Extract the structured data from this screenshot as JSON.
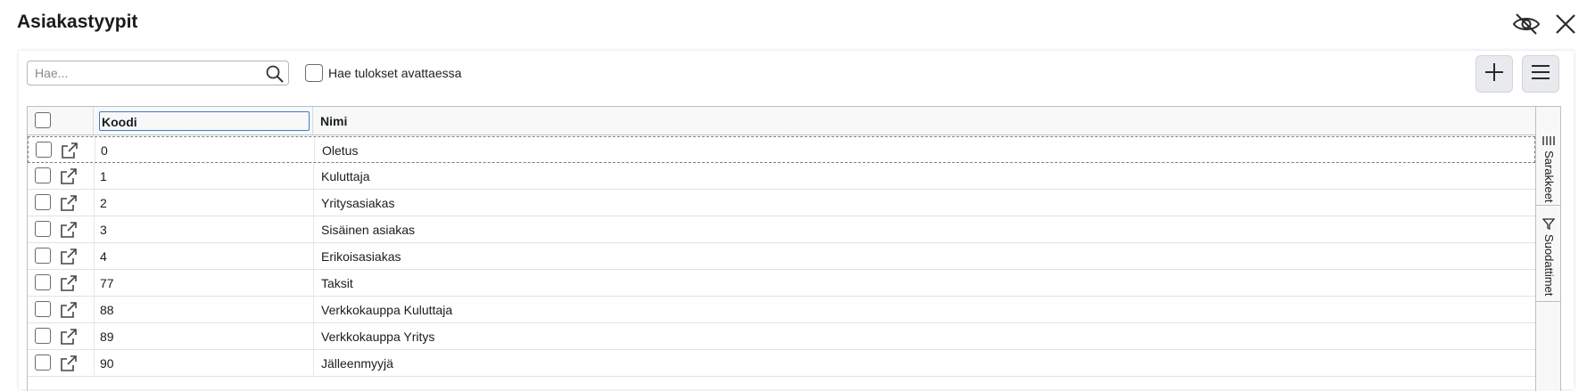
{
  "dialog": {
    "title": "Asiakastyypit"
  },
  "icons": {
    "hide": "eye-off-icon",
    "close": "close-icon",
    "search": "search-icon",
    "add": "plus-icon",
    "menu": "hamburger-menu-icon",
    "open_row": "open-external-icon",
    "columns": "columns-icon",
    "filter": "filter-icon"
  },
  "toolbar": {
    "search_placeholder": "Hae...",
    "search_value": "",
    "search_on_open_label": "Hae tulokset avattaessa",
    "search_on_open_checked": false
  },
  "grid": {
    "headers": {
      "code": "Koodi",
      "name": "Nimi"
    },
    "rows": [
      {
        "code": "0",
        "name": "Oletus"
      },
      {
        "code": "1",
        "name": "Kuluttaja"
      },
      {
        "code": "2",
        "name": "Yritysasiakas"
      },
      {
        "code": "3",
        "name": "Sisäinen asiakas"
      },
      {
        "code": "4",
        "name": "Erikoisasiakas"
      },
      {
        "code": "77",
        "name": "Taksit"
      },
      {
        "code": "88",
        "name": "Verkkokauppa Kuluttaja"
      },
      {
        "code": "89",
        "name": "Verkkokauppa Yritys"
      },
      {
        "code": "90",
        "name": "Jälleenmyyjä"
      }
    ],
    "side_panel": {
      "columns_label": "Sarakkeet",
      "filters_label": "Suodattimet"
    }
  },
  "colors": {
    "focus_border": "#3d7ccb",
    "header_bg": "#f8f8f8",
    "button_bg": "#e8eaed"
  }
}
